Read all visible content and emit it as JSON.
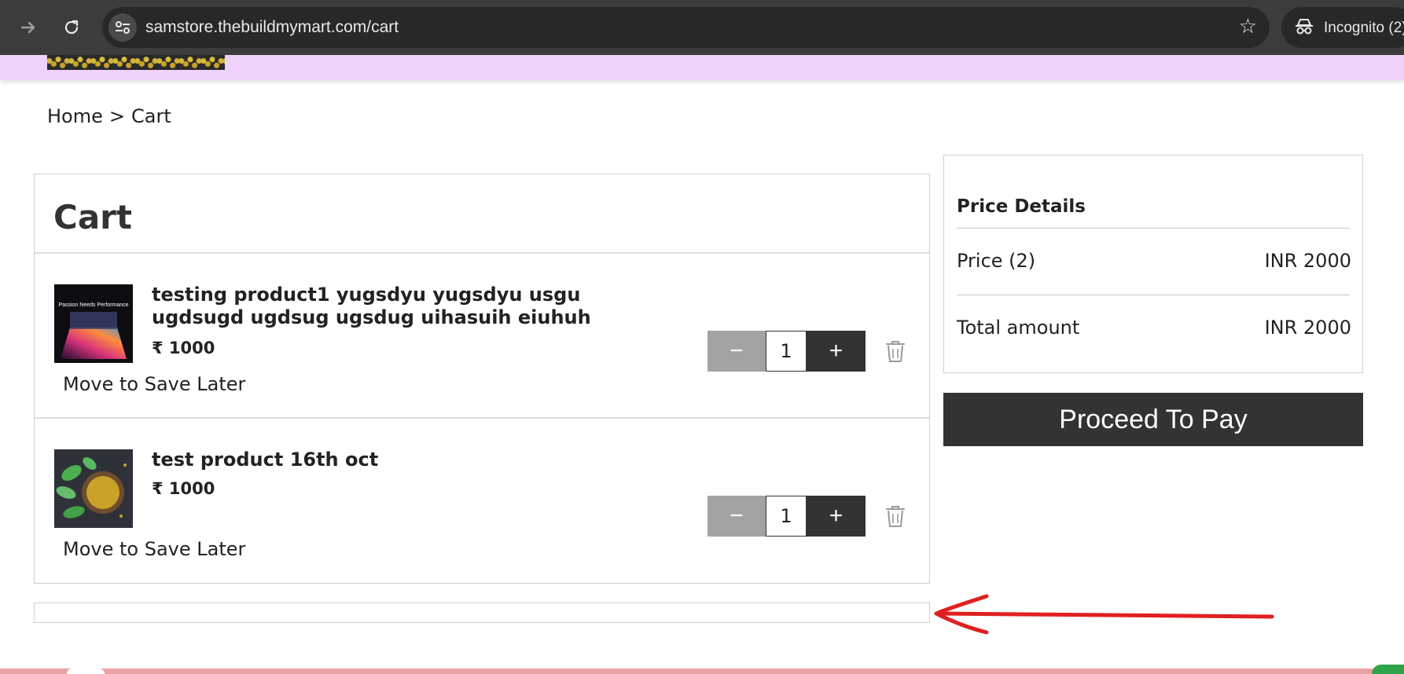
{
  "browser": {
    "url": "samstore.thebuildmymart.com/cart",
    "incognito_label": "Incognito (2)"
  },
  "breadcrumb": {
    "home": "Home",
    "separator": ">",
    "current": "Cart"
  },
  "cart": {
    "title": "Cart",
    "items": [
      {
        "name": "testing product1 yugsdyu yugsdyu usgu ugdsugd ugdsug ugsdug uihasuih eiuhuh",
        "price": "₹ 1000",
        "quantity": "1",
        "save_later": "Move to Save Later",
        "thumbnail_text": "Passion Needs Performance"
      },
      {
        "name": "test product 16th oct",
        "price": "₹ 1000",
        "quantity": "1",
        "save_later": "Move to Save Later"
      }
    ],
    "minus_label": "−",
    "plus_label": "+"
  },
  "price_details": {
    "title": "Price Details",
    "price_label": "Price (2)",
    "price_value": "INR 2000",
    "total_label": "Total amount",
    "total_value": "INR 2000"
  },
  "actions": {
    "proceed_label": "Proceed To Pay"
  },
  "colors": {
    "header_bg": "#efd3fb",
    "button_dark": "#333333",
    "button_minus": "#a3a3a3",
    "annotation_red": "#e02020"
  }
}
